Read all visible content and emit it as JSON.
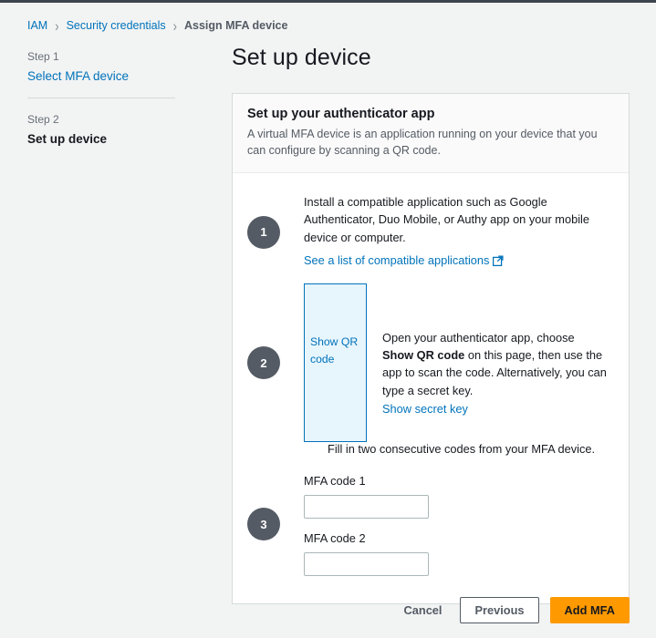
{
  "breadcrumb": {
    "items": [
      {
        "label": "IAM",
        "type": "link"
      },
      {
        "label": "Security credentials",
        "type": "link"
      },
      {
        "label": "Assign MFA device",
        "type": "current"
      }
    ],
    "separator": "›"
  },
  "sidebar": {
    "steps": [
      {
        "number_label": "Step 1",
        "title": "Select MFA device",
        "state": "link"
      },
      {
        "number_label": "Step 2",
        "title": "Set up device",
        "state": "active"
      }
    ]
  },
  "main": {
    "page_title": "Set up device",
    "card": {
      "header_title": "Set up your authenticator app",
      "header_desc": "A virtual MFA device is an application running on your device that you can configure by scanning a QR code.",
      "steps": [
        {
          "number": "1",
          "text": "Install a compatible application such as Google Authenticator, Duo Mobile, or Authy app on your mobile device or computer.",
          "link_label": "See a list of compatible applications",
          "link_icon": "external-link-icon"
        },
        {
          "number": "2",
          "qr_button_label": "Show QR code",
          "desc_part1": "Open your authenticator app, choose ",
          "desc_bold": "Show QR code",
          "desc_part2": " on this page, then use the app to scan the code. Alternatively, you can type a secret key.",
          "secret_link_label": "Show secret key"
        },
        {
          "number": "3",
          "note": "Fill in two consecutive codes from your MFA device.",
          "fields": [
            {
              "label": "MFA code 1",
              "value": "",
              "placeholder": ""
            },
            {
              "label": "MFA code 2",
              "value": "",
              "placeholder": ""
            }
          ]
        }
      ]
    }
  },
  "footer": {
    "cancel_label": "Cancel",
    "previous_label": "Previous",
    "submit_label": "Add MFA"
  },
  "colors": {
    "page_bg": "#f2f3f3",
    "link": "#0073bb",
    "accent_orange": "#ff9900",
    "circle_grey": "#545b64",
    "qr_box_bg": "#e7f5fc"
  }
}
